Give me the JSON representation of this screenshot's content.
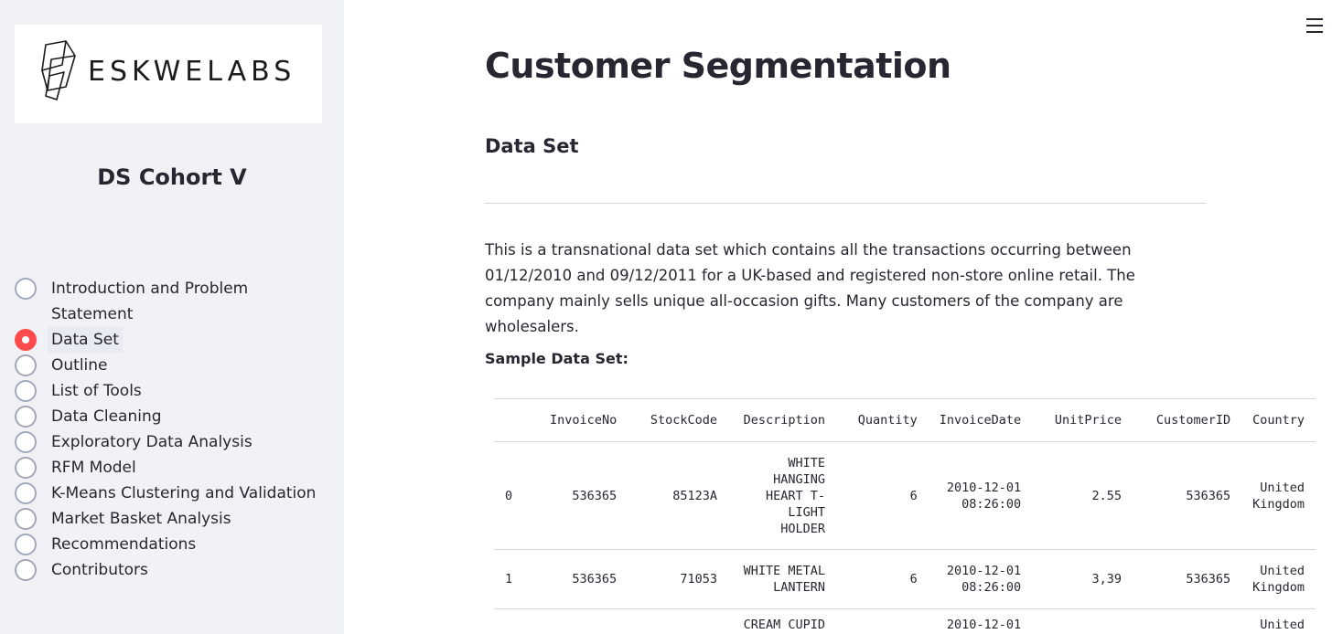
{
  "sidebar": {
    "logo_text": "ESKWELABS",
    "cohort_title": "DS Cohort V",
    "nav_items": [
      {
        "label": "Introduction and Problem Statement",
        "selected": false
      },
      {
        "label": "Data Set",
        "selected": true
      },
      {
        "label": "Outline",
        "selected": false
      },
      {
        "label": "List of Tools",
        "selected": false
      },
      {
        "label": "Data Cleaning",
        "selected": false
      },
      {
        "label": "Exploratory Data Analysis",
        "selected": false
      },
      {
        "label": "RFM Model",
        "selected": false
      },
      {
        "label": "K-Means Clustering and Validation",
        "selected": false
      },
      {
        "label": "Market Basket Analysis",
        "selected": false
      },
      {
        "label": "Recommendations",
        "selected": false
      },
      {
        "label": "Contributors",
        "selected": false
      }
    ]
  },
  "main": {
    "title": "Customer Segmentation",
    "section_title": "Data Set",
    "intro_lines": [
      "This is a transnational data set which contains all the transactions occurring between",
      "01/12/2010 and 09/12/2011 for a UK-based and registered non-store online retail.  The",
      "company mainly sells unique all-occasion gifts. Many customers of the company are wholesalers."
    ],
    "sample_label": "Sample Data Set:",
    "table": {
      "columns": [
        "",
        "InvoiceNo",
        "StockCode",
        "Description",
        "Quantity",
        "InvoiceDate",
        "UnitPrice",
        "CustomerID",
        "Country"
      ],
      "rows": [
        [
          "0",
          "536365",
          "85123A",
          "WHITE HANGING HEART T-LIGHT HOLDER",
          "6",
          "2010-12-01 08:26:00",
          "2.55",
          "536365",
          "United Kingdom"
        ],
        [
          "1",
          "536365",
          "71053",
          "WHITE METAL LANTERN",
          "6",
          "2010-12-01 08:26:00",
          "3,39",
          "536365",
          "United Kingdom"
        ],
        [
          "",
          "",
          "",
          "CREAM CUPID",
          "",
          "2010-12-01",
          "",
          "",
          "United"
        ]
      ]
    }
  },
  "icons": {
    "menu": "hamburger-menu-icon",
    "logo": "eskwelabs-logo-icon"
  },
  "colors": {
    "accent": "#ff4b4b",
    "sidebar_bg": "#f0f2f6",
    "text": "#262730"
  }
}
